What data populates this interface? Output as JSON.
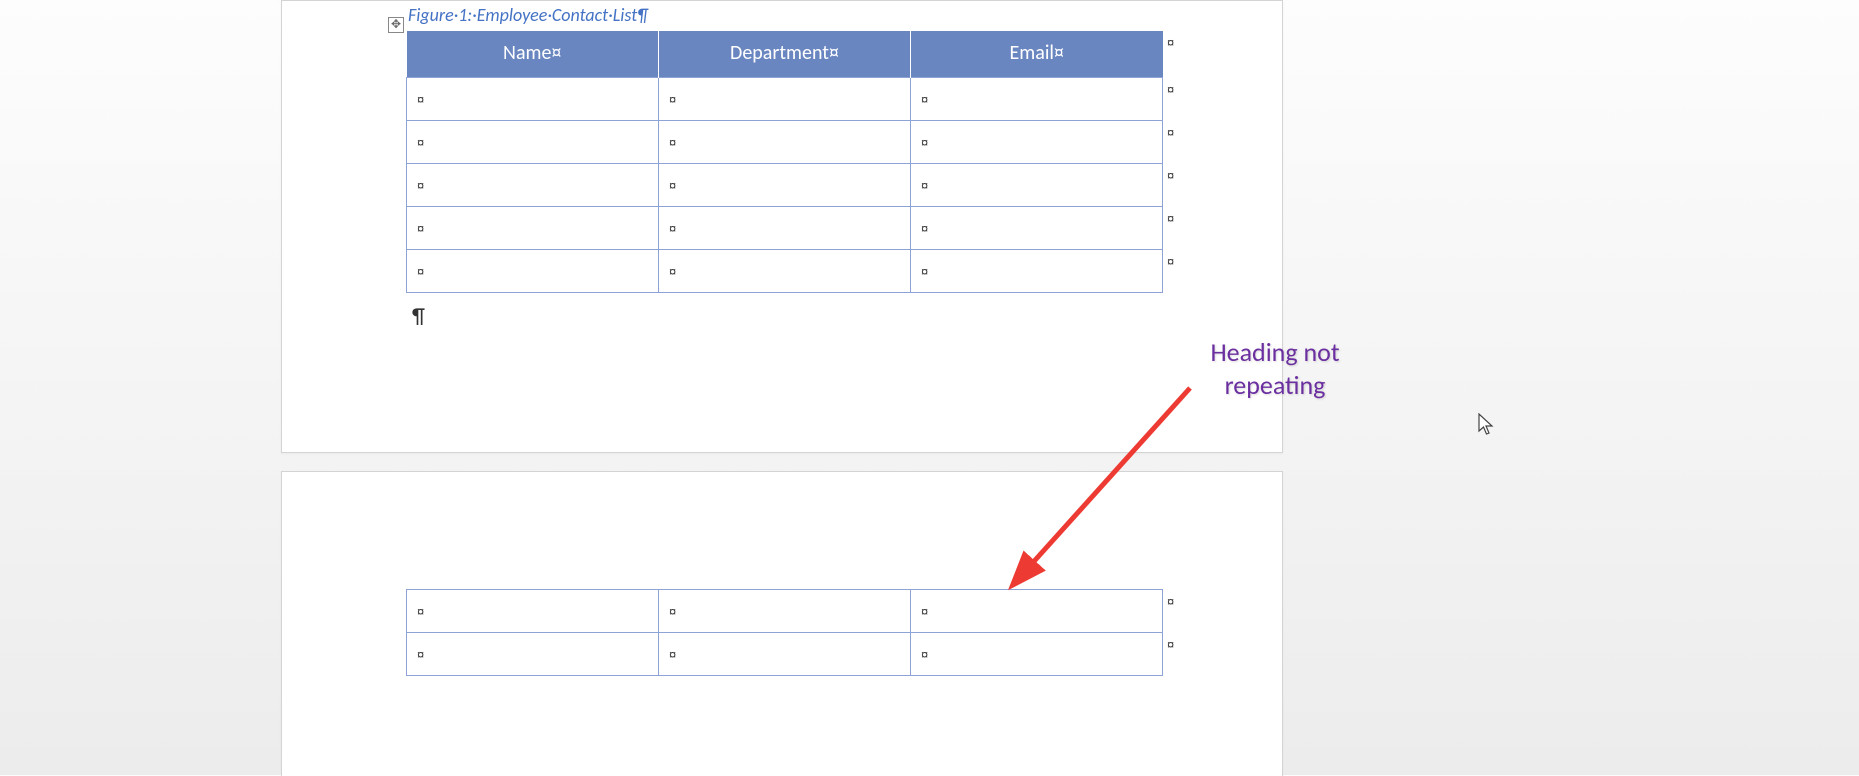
{
  "caption": "Figure·1:·Employee·Contact·List¶",
  "moveHandleGlyph": "✥",
  "table": {
    "headers": [
      "Name¤",
      "Department¤",
      "Email¤"
    ],
    "cellMark": "¤",
    "rowEndMark": "¤",
    "bodyRowsPage1": 5,
    "bodyRowsPage2": 2
  },
  "paragraphMark": "¶",
  "annotation": {
    "line1": "Heading not",
    "line2": "repeating"
  },
  "colors": {
    "headerBg": "#6a86c0",
    "tableBorder": "#8ea3d5",
    "captionColor": "#4472c4",
    "annotationColor": "#6b2fa0",
    "arrowColor": "#ed3b33"
  }
}
